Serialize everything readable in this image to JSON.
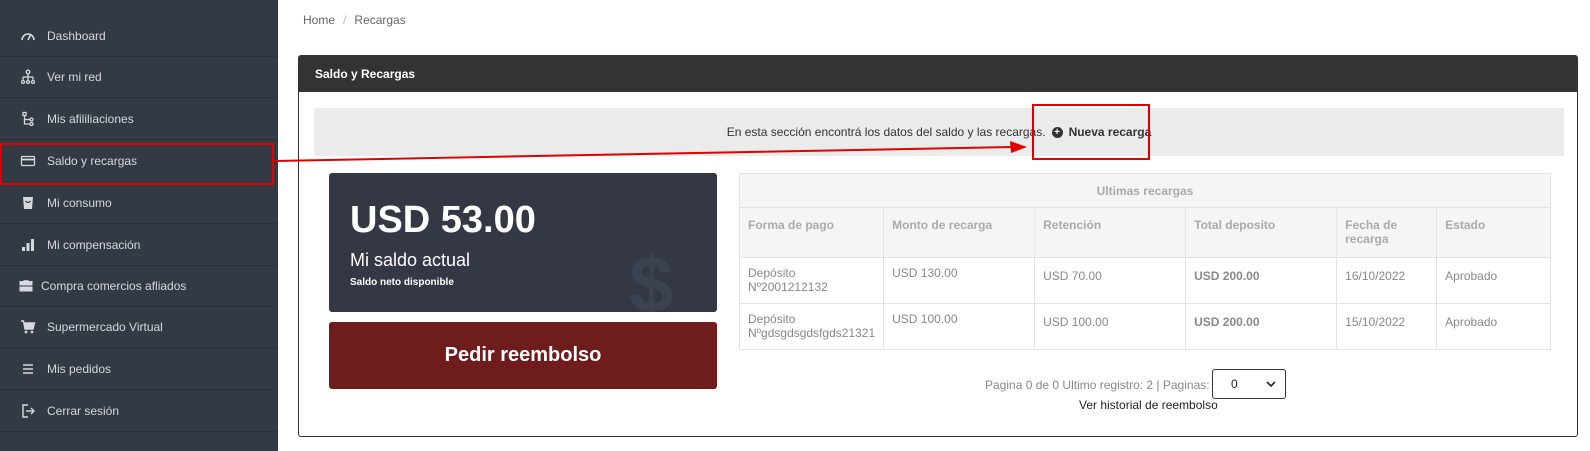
{
  "sidebar": {
    "items": [
      {
        "label": "Dashboard",
        "icon": "speedometer-icon"
      },
      {
        "label": "Ver mi red",
        "icon": "network-icon"
      },
      {
        "label": "Mis afililiaciones",
        "icon": "affiliation-icon"
      },
      {
        "label": "Saldo y recargas",
        "icon": "credit-card-icon"
      },
      {
        "label": "Mi consumo",
        "icon": "cart-basket-icon"
      },
      {
        "label": "Mi compensación",
        "icon": "bar-chart-icon"
      },
      {
        "label": "Compra comercios afliados",
        "icon": "briefcase-icon"
      },
      {
        "label": "Supermercado Virtual",
        "icon": "shopping-cart-icon"
      },
      {
        "label": "Mis pedidos",
        "icon": "list-icon"
      },
      {
        "label": "Cerrar sesión",
        "icon": "logout-icon"
      }
    ]
  },
  "breadcrumb": {
    "home": "Home",
    "separator": "/",
    "current": "Recargas"
  },
  "card": {
    "title": "Saldo y Recargas",
    "info_text": "En esta sección encontrá los datos del saldo y las recargas.",
    "new_recharge": "Nueva recarga"
  },
  "balance": {
    "amount": "USD 53.00",
    "label": "Mi saldo actual",
    "sub": "Saldo neto disponible",
    "watermark": "$"
  },
  "refund_button": "Pedir reembolso",
  "table": {
    "caption": "Ultimas recargas",
    "headers": [
      "Forma de pago",
      "Monto de recarga",
      "Retención",
      "Total deposito",
      "Fecha de recarga",
      "Estado"
    ],
    "rows": [
      [
        "Depósito Nº2001212132",
        "USD 130.00",
        "USD 70.00",
        "USD 200.00",
        "16/10/2022",
        "Aprobado"
      ],
      [
        "Depósito Nºgdsgdsgdsfgds21321",
        "USD 100.00",
        "USD 100.00",
        "USD 200.00",
        "15/10/2022",
        "Aprobado"
      ]
    ]
  },
  "pager": {
    "text": "Pagina 0 de 0 Ultimo registro: 2 | Paginas:",
    "selected": "0"
  },
  "historial_link": "Ver historial de reembolso",
  "colors": {
    "sidebar": "#343a44",
    "header": "#333333",
    "refund": "#6e1c1c",
    "annotation": "#e00000"
  }
}
